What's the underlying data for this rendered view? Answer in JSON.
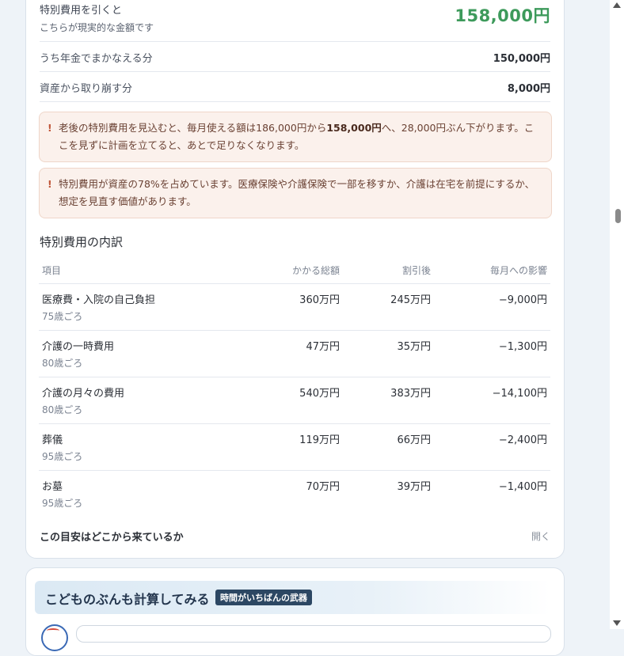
{
  "summary": {
    "label_line1": "特別費用を引くと",
    "label_line2": "こちらが現実的な金額です",
    "amount": "158,000円",
    "amount_color": "#3d9a5b"
  },
  "breakdown_rows": [
    {
      "label": "うち年金でまかなえる分",
      "value": "150,000円"
    },
    {
      "label": "資産から取り崩す分",
      "value": "8,000円"
    }
  ],
  "notices": [
    {
      "mark": "!",
      "text_before": "老後の特別費用を見込むと、毎月使える額は186,000円から",
      "text_bold": "158,000円",
      "text_after": "へ、28,000円ぶん下がります。ここを見ずに計画を立てると、あとで足りなくなります。"
    },
    {
      "mark": "!",
      "text": "特別費用が資産の78%を占めています。医療保険や介護保険で一部を移すか、介護は在宅を前提にするか、想定を見直す価値があります。"
    }
  ],
  "special_costs": {
    "title": "特別費用の内訳",
    "columns": [
      "項目",
      "かかる総額",
      "割引後",
      "毎月への影響"
    ],
    "rows": [
      {
        "item": "医療費・入院の自己負担",
        "age": "75歳ごろ",
        "total": "360万円",
        "discounted": "245万円",
        "monthly": "−9,000円"
      },
      {
        "item": "介護の一時費用",
        "age": "80歳ごろ",
        "total": "47万円",
        "discounted": "35万円",
        "monthly": "−1,300円"
      },
      {
        "item": "介護の月々の費用",
        "age": "80歳ごろ",
        "total": "540万円",
        "discounted": "383万円",
        "monthly": "−14,100円"
      },
      {
        "item": "葬儀",
        "age": "95歳ごろ",
        "total": "119万円",
        "discounted": "66万円",
        "monthly": "−2,400円"
      },
      {
        "item": "お墓",
        "age": "95歳ごろ",
        "total": "70万円",
        "discounted": "39万円",
        "monthly": "−1,400円"
      }
    ]
  },
  "source_toggle": {
    "label": "この目安はどこから来ているか",
    "action": "開く"
  },
  "next_card": {
    "title": "こどものぶんも計算してみる",
    "badge": "時間がいちばんの武器"
  }
}
